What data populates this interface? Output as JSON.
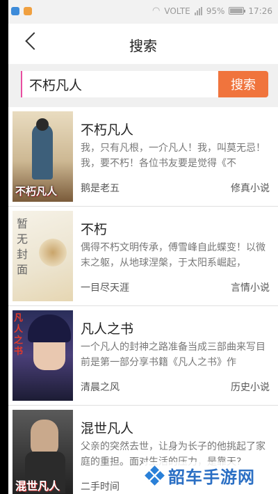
{
  "status": {
    "signal": "VOLTE",
    "battery": "95%",
    "time": "17:26",
    "battery_level": 0.95
  },
  "header": {
    "title": "搜索"
  },
  "search": {
    "value": "不朽凡人",
    "button": "搜索"
  },
  "results": [
    {
      "name": "不朽凡人",
      "intro": "我，只有凡根，一介凡人！我，叫莫无忌！我，要不朽！各位书友要是觉得《不",
      "author": "鹅是老五",
      "genre": "修真小说",
      "cover_text": "不朽凡人"
    },
    {
      "name": "不朽",
      "intro": "偶得不朽文明传承，傅雪峰自此蝶变！以微末之躯，从地球涅槃，于太阳系崛起，",
      "author": "一目尽天涯",
      "genre": "言情小说",
      "cover_text": "暂无封面"
    },
    {
      "name": "凡人之书",
      "intro": "一个凡人的封神之路准备当成三部曲来写目前是第一部分享书籍《凡人之书》作",
      "author": "清晨之风",
      "genre": "历史小说",
      "cover_text": "凡人之书"
    },
    {
      "name": "混世凡人",
      "intro": "父亲的突然去世，让身为长子的他挑起了家庭的重担。面对生活的压力，是靠天?",
      "author": "二手时间",
      "genre": "",
      "cover_text": "混世凡人"
    }
  ],
  "watermark": {
    "text": "韶车手游网"
  },
  "colors": {
    "accent": "#f0743d",
    "watermark": "#2b6fc4"
  }
}
